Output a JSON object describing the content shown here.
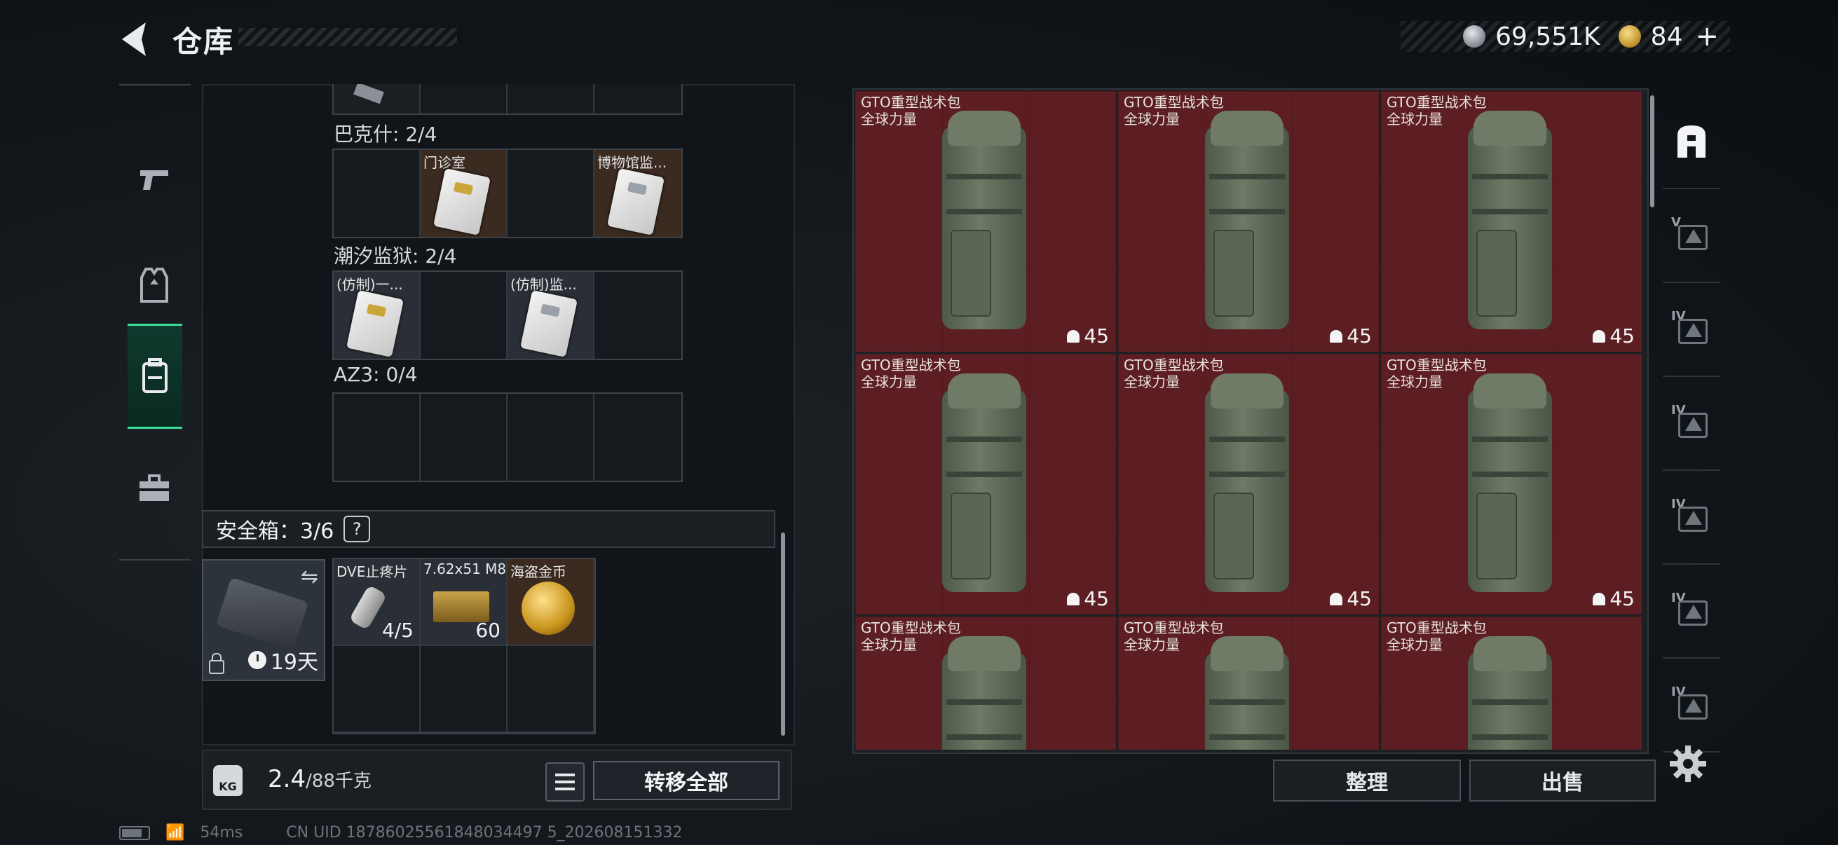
{
  "header": {
    "title": "仓库",
    "currency_silver": "69,551K",
    "currency_gold": "84",
    "plus": "+"
  },
  "left_rail": {
    "items": [
      {
        "icon": "pistol-icon"
      },
      {
        "icon": "armor-vest-icon"
      },
      {
        "icon": "backpack-icon",
        "active": true
      },
      {
        "icon": "toolbox-icon"
      }
    ]
  },
  "collections": [
    {
      "label": "巴克什: 2/4",
      "cells": [
        "",
        "门诊室",
        "",
        "博物馆监..."
      ]
    },
    {
      "label": "潮汐监狱: 2/4",
      "cells": [
        "(仿制)一...",
        "",
        "(仿制)监...",
        ""
      ]
    },
    {
      "label": "AZ3: 0/4",
      "cells": [
        "",
        "",
        "",
        ""
      ]
    }
  ],
  "safe_box": {
    "title": "安全箱：3/6",
    "help": "?",
    "days": "19天",
    "items": [
      {
        "label": "DVE止疼片",
        "count": "4/5"
      },
      {
        "label": "7.62x51 M80",
        "count": "60"
      },
      {
        "label": "海盗金币",
        "count": ""
      }
    ]
  },
  "bottom": {
    "kg_label": "KG",
    "weight_value": "2.4",
    "weight_max": "/88千克",
    "transfer_all": "转移全部"
  },
  "bags": {
    "name": "GTO重型战术包",
    "subtitle": "全球力量",
    "level": "45",
    "count_visible": 9
  },
  "actions": {
    "sort": "整理",
    "sell": "出售"
  },
  "right_rail": {
    "tiers": [
      "V",
      "IV",
      "IV",
      "IV",
      "IV",
      "IV"
    ]
  },
  "status_bar": {
    "ping": "54ms",
    "uid": "CN UID 18786025561848034497 5_202608151332"
  },
  "colors": {
    "accent_green": "#3ddc97",
    "bag_bg": "#5c1e22"
  }
}
